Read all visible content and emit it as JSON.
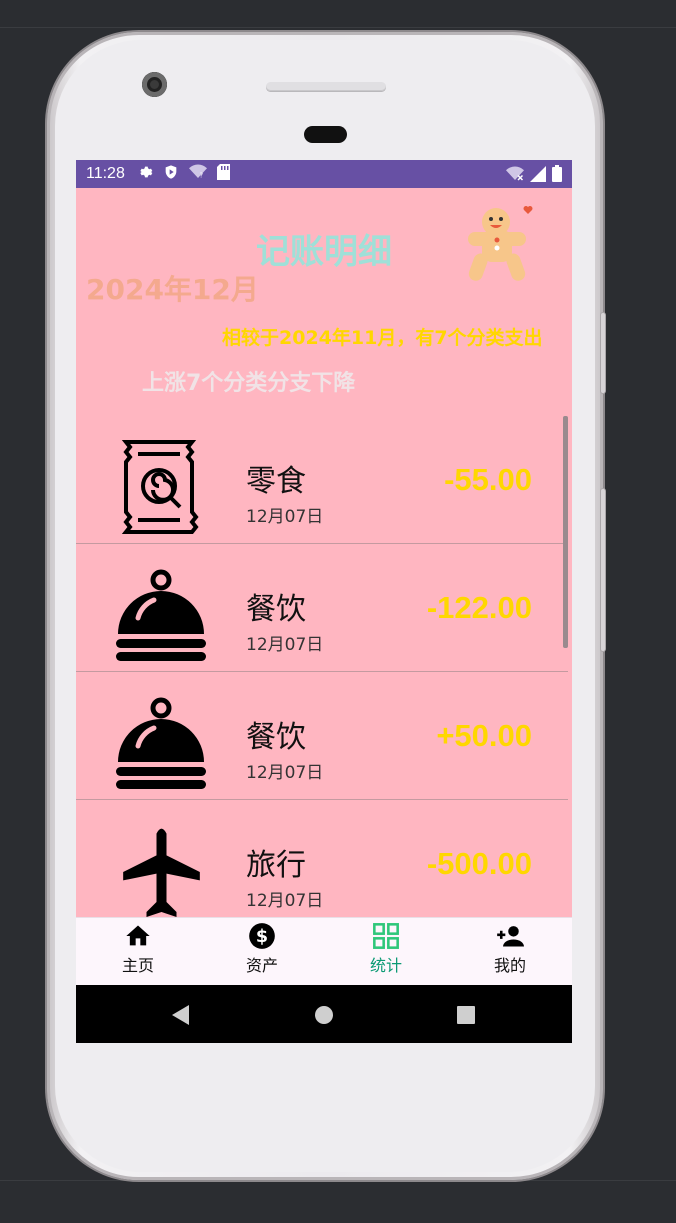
{
  "status_bar": {
    "time": "11:28"
  },
  "header": {
    "title": "记账明细",
    "month": "2024年12月",
    "compare_text": "相较于2024年11月，有7个分类支出",
    "trend_text": "上涨7个分类分支下降"
  },
  "records": [
    {
      "icon": "candy-bag-icon",
      "category": "零食",
      "date": "12月07日",
      "amount": "-55.00"
    },
    {
      "icon": "food-cloche-icon",
      "category": "餐饮",
      "date": "12月07日",
      "amount": "-122.00"
    },
    {
      "icon": "food-cloche-icon",
      "category": "餐饮",
      "date": "12月07日",
      "amount": "+50.00"
    },
    {
      "icon": "airplane-icon",
      "category": "旅行",
      "date": "12月07日",
      "amount": "-500.00"
    }
  ],
  "bottom_nav": [
    {
      "icon": "home-icon",
      "label": "主页",
      "active": false
    },
    {
      "icon": "dollar-icon",
      "label": "资产",
      "active": false
    },
    {
      "icon": "grid-icon",
      "label": "统计",
      "active": true
    },
    {
      "icon": "add-user-icon",
      "label": "我的",
      "active": false
    }
  ],
  "colors": {
    "status_bar": "#6750a4",
    "background": "#ffb6c1",
    "title": "#9fe0d8",
    "month": "#f4a98e",
    "amount": "#ffd700",
    "active_nav": "#0b9a74"
  }
}
